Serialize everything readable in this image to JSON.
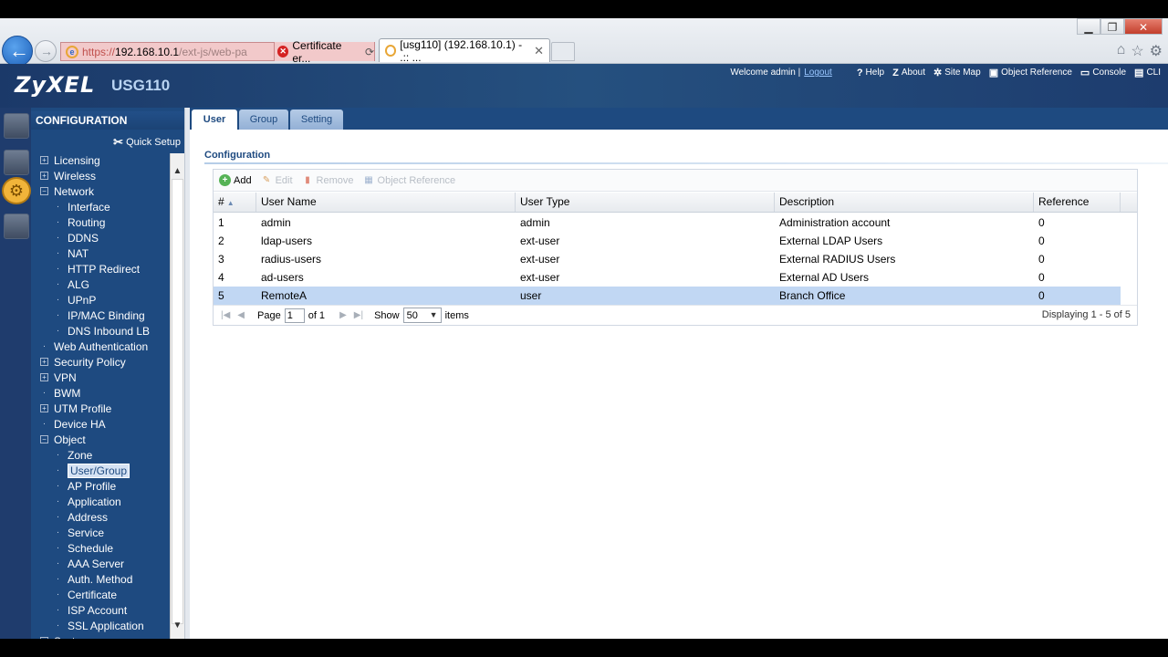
{
  "browser": {
    "address_scheme": "https://",
    "address_host": "192.168.10.1",
    "address_path": "/ext-js/web-pa",
    "cert_error": "Certificate er...",
    "tab_title": "[usg110] (192.168.10.1) - .:: ..."
  },
  "header": {
    "brand": "ZyXEL",
    "model": "USG110",
    "welcome": "Welcome admin |",
    "logout": "Logout",
    "links": [
      {
        "label": "Help",
        "icon": "help-icon"
      },
      {
        "label": "About",
        "icon": "about-icon"
      },
      {
        "label": "Site Map",
        "icon": "sitemap-icon"
      },
      {
        "label": "Object Reference",
        "icon": "object-reference-icon"
      },
      {
        "label": "Console",
        "icon": "console-icon"
      },
      {
        "label": "CLI",
        "icon": "cli-icon"
      }
    ]
  },
  "sidebar": {
    "title": "CONFIGURATION",
    "quick_setup": "Quick Setup",
    "items": [
      {
        "label": "Licensing",
        "level": 0,
        "kind": "plus"
      },
      {
        "label": "Wireless",
        "level": 0,
        "kind": "plus"
      },
      {
        "label": "Network",
        "level": 0,
        "kind": "minus"
      },
      {
        "label": "Interface",
        "level": 1,
        "kind": "dot"
      },
      {
        "label": "Routing",
        "level": 1,
        "kind": "dot"
      },
      {
        "label": "DDNS",
        "level": 1,
        "kind": "dot"
      },
      {
        "label": "NAT",
        "level": 1,
        "kind": "dot"
      },
      {
        "label": "HTTP Redirect",
        "level": 1,
        "kind": "dot"
      },
      {
        "label": "ALG",
        "level": 1,
        "kind": "dot"
      },
      {
        "label": "UPnP",
        "level": 1,
        "kind": "dot"
      },
      {
        "label": "IP/MAC Binding",
        "level": 1,
        "kind": "dot"
      },
      {
        "label": "DNS Inbound LB",
        "level": 1,
        "kind": "dot"
      },
      {
        "label": "Web Authentication",
        "level": 0,
        "kind": "dot"
      },
      {
        "label": "Security Policy",
        "level": 0,
        "kind": "plus"
      },
      {
        "label": "VPN",
        "level": 0,
        "kind": "plus"
      },
      {
        "label": "BWM",
        "level": 0,
        "kind": "dot"
      },
      {
        "label": "UTM Profile",
        "level": 0,
        "kind": "plus"
      },
      {
        "label": "Device HA",
        "level": 0,
        "kind": "dot"
      },
      {
        "label": "Object",
        "level": 0,
        "kind": "minus"
      },
      {
        "label": "Zone",
        "level": 1,
        "kind": "dot"
      },
      {
        "label": "User/Group",
        "level": 1,
        "kind": "dot",
        "selected": true
      },
      {
        "label": "AP Profile",
        "level": 1,
        "kind": "dot"
      },
      {
        "label": "Application",
        "level": 1,
        "kind": "dot"
      },
      {
        "label": "Address",
        "level": 1,
        "kind": "dot"
      },
      {
        "label": "Service",
        "level": 1,
        "kind": "dot"
      },
      {
        "label": "Schedule",
        "level": 1,
        "kind": "dot"
      },
      {
        "label": "AAA Server",
        "level": 1,
        "kind": "dot"
      },
      {
        "label": "Auth. Method",
        "level": 1,
        "kind": "dot"
      },
      {
        "label": "Certificate",
        "level": 1,
        "kind": "dot"
      },
      {
        "label": "ISP Account",
        "level": 1,
        "kind": "dot"
      },
      {
        "label": "SSL Application",
        "level": 1,
        "kind": "dot"
      },
      {
        "label": "System",
        "level": 0,
        "kind": "plus"
      }
    ]
  },
  "main": {
    "tabs": [
      {
        "label": "User",
        "active": true
      },
      {
        "label": "Group",
        "active": false
      },
      {
        "label": "Setting",
        "active": false
      }
    ],
    "section_title": "Configuration",
    "toolbar": {
      "add": "Add",
      "edit": "Edit",
      "remove": "Remove",
      "object_reference": "Object Reference"
    },
    "table": {
      "columns": [
        "#",
        "User Name",
        "User Type",
        "Description",
        "Reference"
      ],
      "rows": [
        [
          "1",
          "admin",
          "admin",
          "Administration account",
          "0"
        ],
        [
          "2",
          "ldap-users",
          "ext-user",
          "External LDAP Users",
          "0"
        ],
        [
          "3",
          "radius-users",
          "ext-user",
          "External RADIUS Users",
          "0"
        ],
        [
          "4",
          "ad-users",
          "ext-user",
          "External AD Users",
          "0"
        ],
        [
          "5",
          "RemoteA",
          "user",
          "Branch Office",
          "0"
        ]
      ],
      "selected_row": 4
    },
    "pager": {
      "page_label": "Page",
      "page_value": "1",
      "of_label": "of 1",
      "show_label": "Show",
      "show_value": "50",
      "items_label": "items",
      "displaying": "Displaying 1 - 5 of 5"
    }
  }
}
